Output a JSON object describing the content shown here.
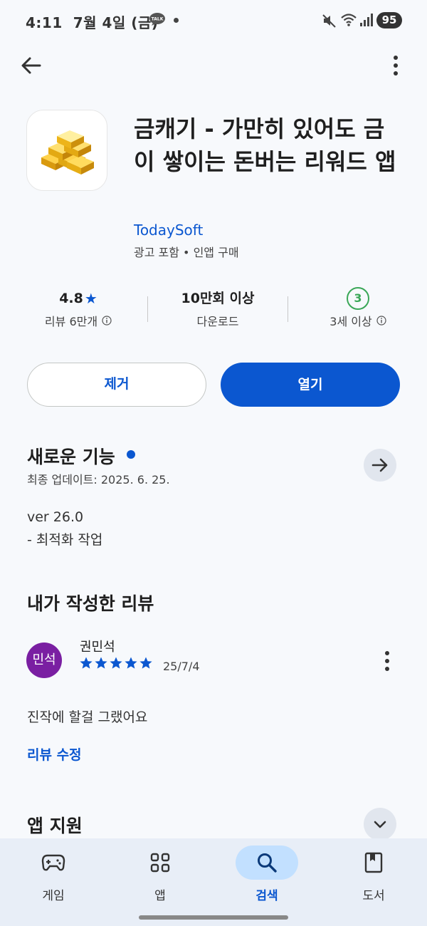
{
  "status_bar": {
    "time": "4:11",
    "date": "7월 4일 (금)",
    "battery": "95",
    "talk_icon": "kakaotalk-icon",
    "icons": [
      "mute-icon",
      "wifi-icon",
      "signal-icon"
    ]
  },
  "app": {
    "title": "금캐기 - 가만히 있어도 금이 쌓이는 돈버는 리워드 앱",
    "developer": "TodaySoft",
    "meta": "광고 포함 • 인앱 구매",
    "icon": "gold-bars-icon"
  },
  "stats": {
    "rating": "4.8",
    "rating_label": "리뷰 6만개",
    "downloads": "10만회 이상",
    "downloads_label": "다운로드",
    "age_rating": "3",
    "age_label": "3세 이상"
  },
  "actions": {
    "uninstall_label": "제거",
    "open_label": "열기"
  },
  "whats_new": {
    "title": "새로운 기능",
    "last_update": "최종 업데이트: 2025. 6. 25.",
    "version": "ver 26.0",
    "notes": "- 최적화 작업"
  },
  "my_review": {
    "title": "내가 작성한 리뷰",
    "avatar_text": "민석",
    "reviewer_name": "권민석",
    "stars": 5,
    "date": "25/7/4",
    "text": "진작에 할걸 그랬어요",
    "edit_label": "리뷰 수정"
  },
  "app_support": {
    "title": "앱 지원"
  },
  "bottom_nav": {
    "items": [
      {
        "label": "게임",
        "icon": "gamepad-icon",
        "active": false
      },
      {
        "label": "앱",
        "icon": "apps-grid-icon",
        "active": false
      },
      {
        "label": "검색",
        "icon": "search-icon",
        "active": true
      },
      {
        "label": "도서",
        "icon": "book-icon",
        "active": false
      }
    ]
  },
  "colors": {
    "accent": "#0b57d0",
    "age_badge": "#3aa757",
    "avatar": "#7a1fa2",
    "nav_active": "#c2e0ff"
  }
}
